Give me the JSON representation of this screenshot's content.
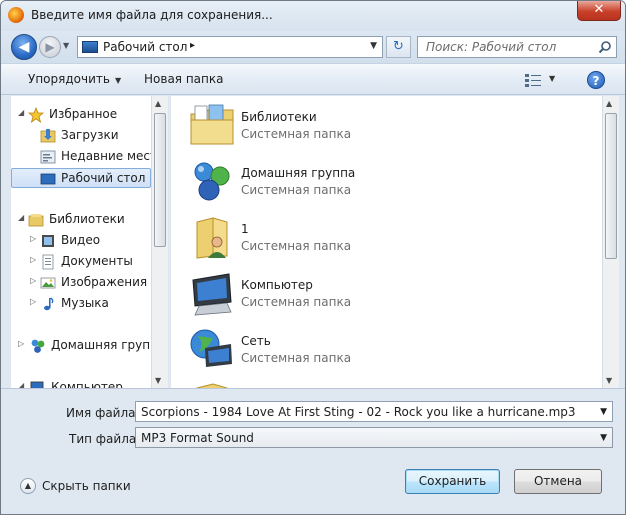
{
  "window": {
    "title": "Введите имя файла для сохранения...",
    "close_label": "✕"
  },
  "nav": {
    "back_icon": "◀",
    "forward_icon": "▶",
    "address_path": "Рабочий стол",
    "address_separator": "▸",
    "refresh_icon": "↻",
    "search_placeholder": "Поиск: Рабочий стол"
  },
  "toolbar": {
    "organize_label": "Упорядочить",
    "new_folder_label": "Новая папка",
    "help_label": "?"
  },
  "sidebar": {
    "items": [
      {
        "label": "Избранное",
        "icon": "star-icon",
        "expander": "◢"
      },
      {
        "label": "Загрузки",
        "icon": "downloads-folder-icon"
      },
      {
        "label": "Недавние места",
        "icon": "recent-places-icon"
      },
      {
        "label": "Рабочий стол",
        "icon": "desktop-icon",
        "selected": true
      },
      {
        "label": "Библиотеки",
        "icon": "libraries-icon",
        "expander": "◢"
      },
      {
        "label": "Видео",
        "icon": "video-icon",
        "expander": "▷"
      },
      {
        "label": "Документы",
        "icon": "documents-icon",
        "expander": "▷"
      },
      {
        "label": "Изображения",
        "icon": "pictures-icon",
        "expander": "▷"
      },
      {
        "label": "Музыка",
        "icon": "music-icon",
        "expander": "▷"
      },
      {
        "label": "Домашняя группа",
        "icon": "homegroup-icon",
        "expander": "▷"
      },
      {
        "label": "Компьютер",
        "icon": "computer-icon",
        "expander": "◢"
      }
    ]
  },
  "files": [
    {
      "name": "Библиотеки",
      "type": "Системная папка",
      "icon": "libraries-folder-icon"
    },
    {
      "name": "Домашняя группа",
      "type": "Системная папка",
      "icon": "homegroup-icon"
    },
    {
      "name": "1",
      "type": "Системная папка",
      "icon": "user-folder-icon"
    },
    {
      "name": "Компьютер",
      "type": "Системная папка",
      "icon": "computer-icon"
    },
    {
      "name": "Сеть",
      "type": "Системная папка",
      "icon": "network-icon"
    }
  ],
  "form": {
    "filename_label": "Имя файла:",
    "filename_value": "Scorpions - 1984 Love At First Sting - 02 - Rock you like a hurricane.mp3",
    "filetype_label": "Тип файла:",
    "filetype_value": "MP3 Format Sound",
    "hide_folders_label": "Скрыть папки",
    "save_label": "Сохранить",
    "cancel_label": "Отмена"
  }
}
